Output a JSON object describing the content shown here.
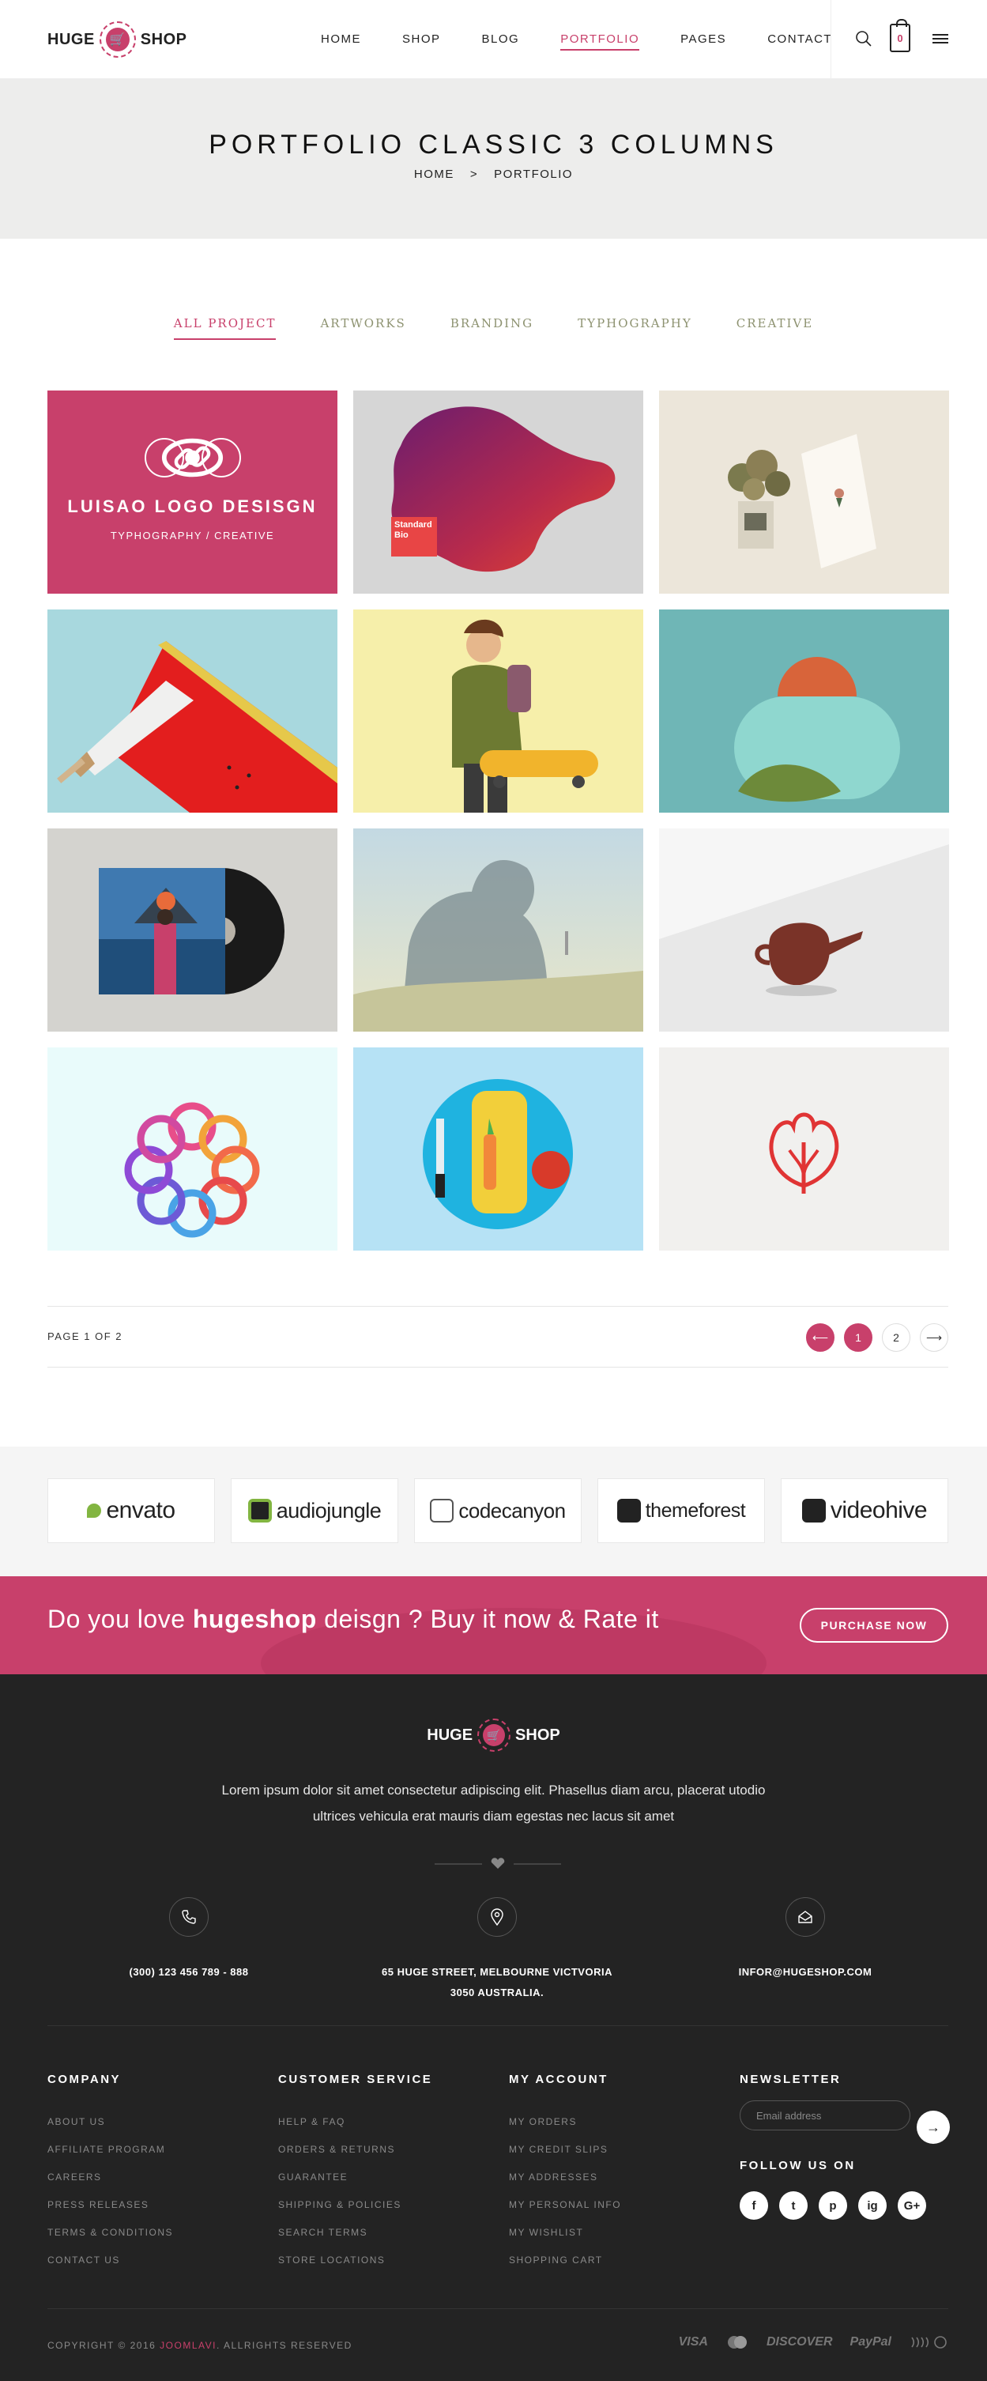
{
  "brand": {
    "left": "HUGE",
    "right": "SHOP"
  },
  "nav": [
    "HOME",
    "SHOP",
    "BLOG",
    "PORTFOLIO",
    "PAGES",
    "CONTACT"
  ],
  "cart_count": "0",
  "page_title": "PORTFOLIO CLASSIC 3 COLUMNS",
  "breadcrumb": {
    "home": "HOME",
    "separator": ">",
    "current": "PORTFOLIO"
  },
  "filters": [
    "ALL PROJECT",
    "ARTWORKS",
    "BRANDING",
    "TYPHOGRAPHY",
    "CREATIVE"
  ],
  "featured": {
    "title": "LUISAO LOGO DESISGN",
    "subtitle": "TYPHOGRAPHY / CREATIVE"
  },
  "tile_texts": {
    "standard_bio": "Standard Bio"
  },
  "pagination": {
    "text": "PAGE 1 OF 2",
    "pages": [
      "1",
      "2"
    ],
    "prev": "⟵",
    "next": "⟶"
  },
  "partners": [
    "envato",
    "audiojungle",
    "codecanyon",
    "themeforest",
    "videohive"
  ],
  "promo": {
    "pre": "Do you love ",
    "bold": "hugeshop",
    "post": " deisgn ? Buy it now & Rate it",
    "button": "PURCHASE NOW"
  },
  "footer": {
    "description": "Lorem ipsum dolor sit amet consectetur adipiscing elit. Phasellus diam arcu, placerat utodio ultrices vehicula erat mauris diam egestas nec lacus sit amet",
    "phone": "(300) 123 456 789 - 888",
    "address_line1": "65 HUGE STREET, MELBOURNE VICTVORIA",
    "address_line2": "3050 AUSTRALIA.",
    "email": "INFOR@HUGESHOP.COM",
    "columns": [
      {
        "title": "COMPANY",
        "items": [
          "ABOUT US",
          "AFFILIATE PROGRAM",
          "CAREERS",
          "PRESS RELEASES",
          "TERMS & CONDITIONS",
          "CONTACT US"
        ]
      },
      {
        "title": "CUSTOMER SERVICE",
        "items": [
          "HELP & FAQ",
          "ORDERS & RETURNS",
          "GUARANTEE",
          "SHIPPING & POLICIES",
          "SEARCH TERMS",
          "STORE LOCATIONS"
        ]
      },
      {
        "title": "MY ACCOUNT",
        "items": [
          "MY ORDERS",
          "MY CREDIT SLIPS",
          "MY ADDRESSES",
          "MY PERSONAL INFO",
          "MY WISHLIST",
          "SHOPPING CART"
        ]
      }
    ],
    "newsletter_title": "NEWSLETTER",
    "newsletter_placeholder": "Email address",
    "follow_title": "FOLLOW US ON",
    "social": [
      "f",
      "t",
      "p",
      "ig",
      "G+"
    ],
    "copyright_pre": "COPYRIGHT © 2016 ",
    "copyright_brand": "JOOMLAVI",
    "copyright_post": ". ALLRIGHTS RESERVED",
    "payments": [
      "VISA",
      "mastercard",
      "DISCOVER",
      "PayPal",
      "contactless"
    ]
  },
  "colors": {
    "accent": "#c8406b",
    "dark": "#232323",
    "filter": "#8d9270"
  }
}
